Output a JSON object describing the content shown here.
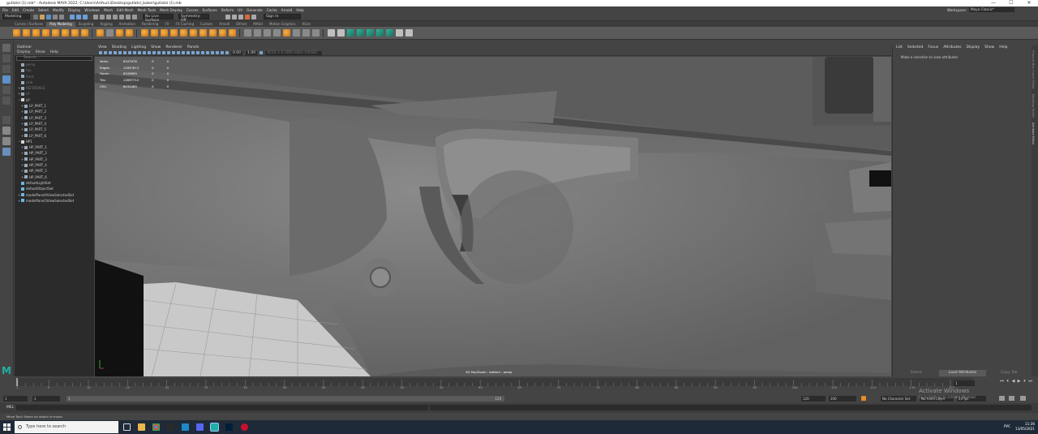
{
  "window": {
    "title": "gutlatsl (1).mb* - Autodesk MAYA 2022: C:\\Users\\ArthurL\\Desktop\\gutlatsl_baker\\gutlatsl (1).mb",
    "controls": [
      "—",
      "☐",
      "✕"
    ]
  },
  "menubar": {
    "items": [
      "File",
      "Edit",
      "Create",
      "Select",
      "Modify",
      "Display",
      "Windows",
      "Mesh",
      "Edit Mesh",
      "Mesh Tools",
      "Mesh Display",
      "Curves",
      "Surfaces",
      "Deform",
      "UV",
      "Generate",
      "Cache",
      "Arnold",
      "Help"
    ],
    "workspace_label": "Workspace:",
    "workspace_value": "Maya Classic*"
  },
  "statusline": {
    "mode": "Modeling",
    "live_surface": "No Live Surface",
    "symmetry": "Symmetry: Off",
    "signin": "Sign In"
  },
  "shelf": {
    "tabs": [
      "Curves / Surfaces",
      "Poly Modeling",
      "Sculpting",
      "Rigging",
      "Animation",
      "Rendering",
      "FX",
      "FX Caching",
      "Custom",
      "Arnold",
      "Bifrost",
      "MASH",
      "Motion Graphics",
      "XGen"
    ],
    "active_tab": "Poly Modeling"
  },
  "outliner": {
    "title": "Outliner",
    "menu": [
      "Display",
      "Show",
      "Help"
    ],
    "search_placeholder": "Search...",
    "items": [
      {
        "label": "persp",
        "indent": 1,
        "dim": true,
        "expand": ""
      },
      {
        "label": "top",
        "indent": 1,
        "dim": true,
        "expand": ""
      },
      {
        "label": "front",
        "indent": 1,
        "dim": true,
        "expand": ""
      },
      {
        "label": "side",
        "indent": 1,
        "dim": true,
        "expand": ""
      },
      {
        "label": "REFERENCE",
        "indent": 1,
        "dim": true,
        "expand": "+"
      },
      {
        "label": "LP",
        "indent": 1,
        "dim": true,
        "expand": "+"
      },
      {
        "label": "LP",
        "indent": 1,
        "dim": false,
        "expand": "−"
      },
      {
        "label": "LP_PART_1",
        "indent": 2,
        "dim": false,
        "expand": "+"
      },
      {
        "label": "LP_PART_2",
        "indent": 2,
        "dim": false,
        "expand": "+"
      },
      {
        "label": "LP_PART_3",
        "indent": 2,
        "dim": false,
        "expand": "+"
      },
      {
        "label": "LP_PART_4",
        "indent": 2,
        "dim": false,
        "expand": "+"
      },
      {
        "label": "LP_PART_5",
        "indent": 2,
        "dim": false,
        "expand": "+"
      },
      {
        "label": "LP_PART_6",
        "indent": 2,
        "dim": false,
        "expand": "+"
      },
      {
        "label": "HP1",
        "indent": 1,
        "dim": false,
        "expand": "−"
      },
      {
        "label": "HP_PART_1",
        "indent": 2,
        "dim": false,
        "expand": "+"
      },
      {
        "label": "HP_PART_2",
        "indent": 2,
        "dim": false,
        "expand": "+"
      },
      {
        "label": "HP_PART_3",
        "indent": 2,
        "dim": false,
        "expand": "+"
      },
      {
        "label": "HP_PART_4",
        "indent": 2,
        "dim": false,
        "expand": "+"
      },
      {
        "label": "HP_PART_5",
        "indent": 2,
        "dim": false,
        "expand": "+"
      },
      {
        "label": "HP_PART_6",
        "indent": 2,
        "dim": false,
        "expand": "+"
      },
      {
        "label": "defaultLightSet",
        "indent": 1,
        "dim": false,
        "expand": ""
      },
      {
        "label": "defaultObjectSet",
        "indent": 1,
        "dim": false,
        "expand": ""
      },
      {
        "label": "modelPanel4ViewSelectedSet",
        "indent": 1,
        "dim": false,
        "expand": "+"
      },
      {
        "label": "modelPanel3ViewSelectedSet",
        "indent": 1,
        "dim": false,
        "expand": "+"
      }
    ]
  },
  "viewport": {
    "menu": [
      "View",
      "Shading",
      "Lighting",
      "Show",
      "Renderer",
      "Panels"
    ],
    "near_clip": "0.00",
    "far_clip": "1.00",
    "color_space": "ACES 1.0 SDR-video (sRGB)",
    "hud": [
      {
        "label": "Verts:",
        "a": "6347978",
        "b": "0",
        "c": "0"
      },
      {
        "label": "Edges:",
        "a": "12697813",
        "b": "0",
        "c": "0"
      },
      {
        "label": "Faces:",
        "a": "6349899",
        "b": "0",
        "c": "0"
      },
      {
        "label": "Tris:",
        "a": "12697712",
        "b": "0",
        "c": "0"
      },
      {
        "label": "UVs:",
        "a": "6432489",
        "b": "0",
        "c": "0"
      }
    ],
    "camera_label": "2D Pan/Zoom : bottom : persp"
  },
  "attribute_editor": {
    "menu": [
      "List",
      "Selected",
      "Focus",
      "Attributes",
      "Display",
      "Show",
      "Help"
    ],
    "message": "Make a selection to view attributes",
    "buttons": [
      "Select",
      "Load Attributes",
      "Copy Tab"
    ]
  },
  "right_tabs": [
    "Channel Box / Layer Editor",
    "Modeling Toolkit",
    "Attribute Editor"
  ],
  "timeslider": {
    "ticks": [
      "1",
      "5",
      "10",
      "15",
      "20",
      "25",
      "30",
      "35",
      "40",
      "45",
      "50",
      "55",
      "60",
      "65",
      "70",
      "75",
      "80",
      "85",
      "90",
      "95",
      "100",
      "105",
      "110",
      "115",
      "120"
    ],
    "current_frame": "1"
  },
  "range": {
    "start": "1",
    "anim_start": "1",
    "range_start": "1",
    "range_end": "120",
    "anim_end": "120",
    "end": "200",
    "char_set": "No Character Set",
    "anim_layer": "No Anim Layer",
    "fps": "24 fps"
  },
  "command": {
    "lang": "MEL"
  },
  "helpline": "Move Tool: Select an object to move.",
  "watermark": {
    "line1": "Activate Windows",
    "line2": "Go to Settings to activate Windows."
  },
  "taskbar": {
    "search_placeholder": "Type here to search",
    "tray_lang": "РУС",
    "time": "11:36",
    "date": "13/05/2021"
  },
  "colors": {
    "accent_orange": "#f7b34a",
    "maya_teal": "#1fb0a5",
    "viewport_grey": "#6a6a6a"
  }
}
